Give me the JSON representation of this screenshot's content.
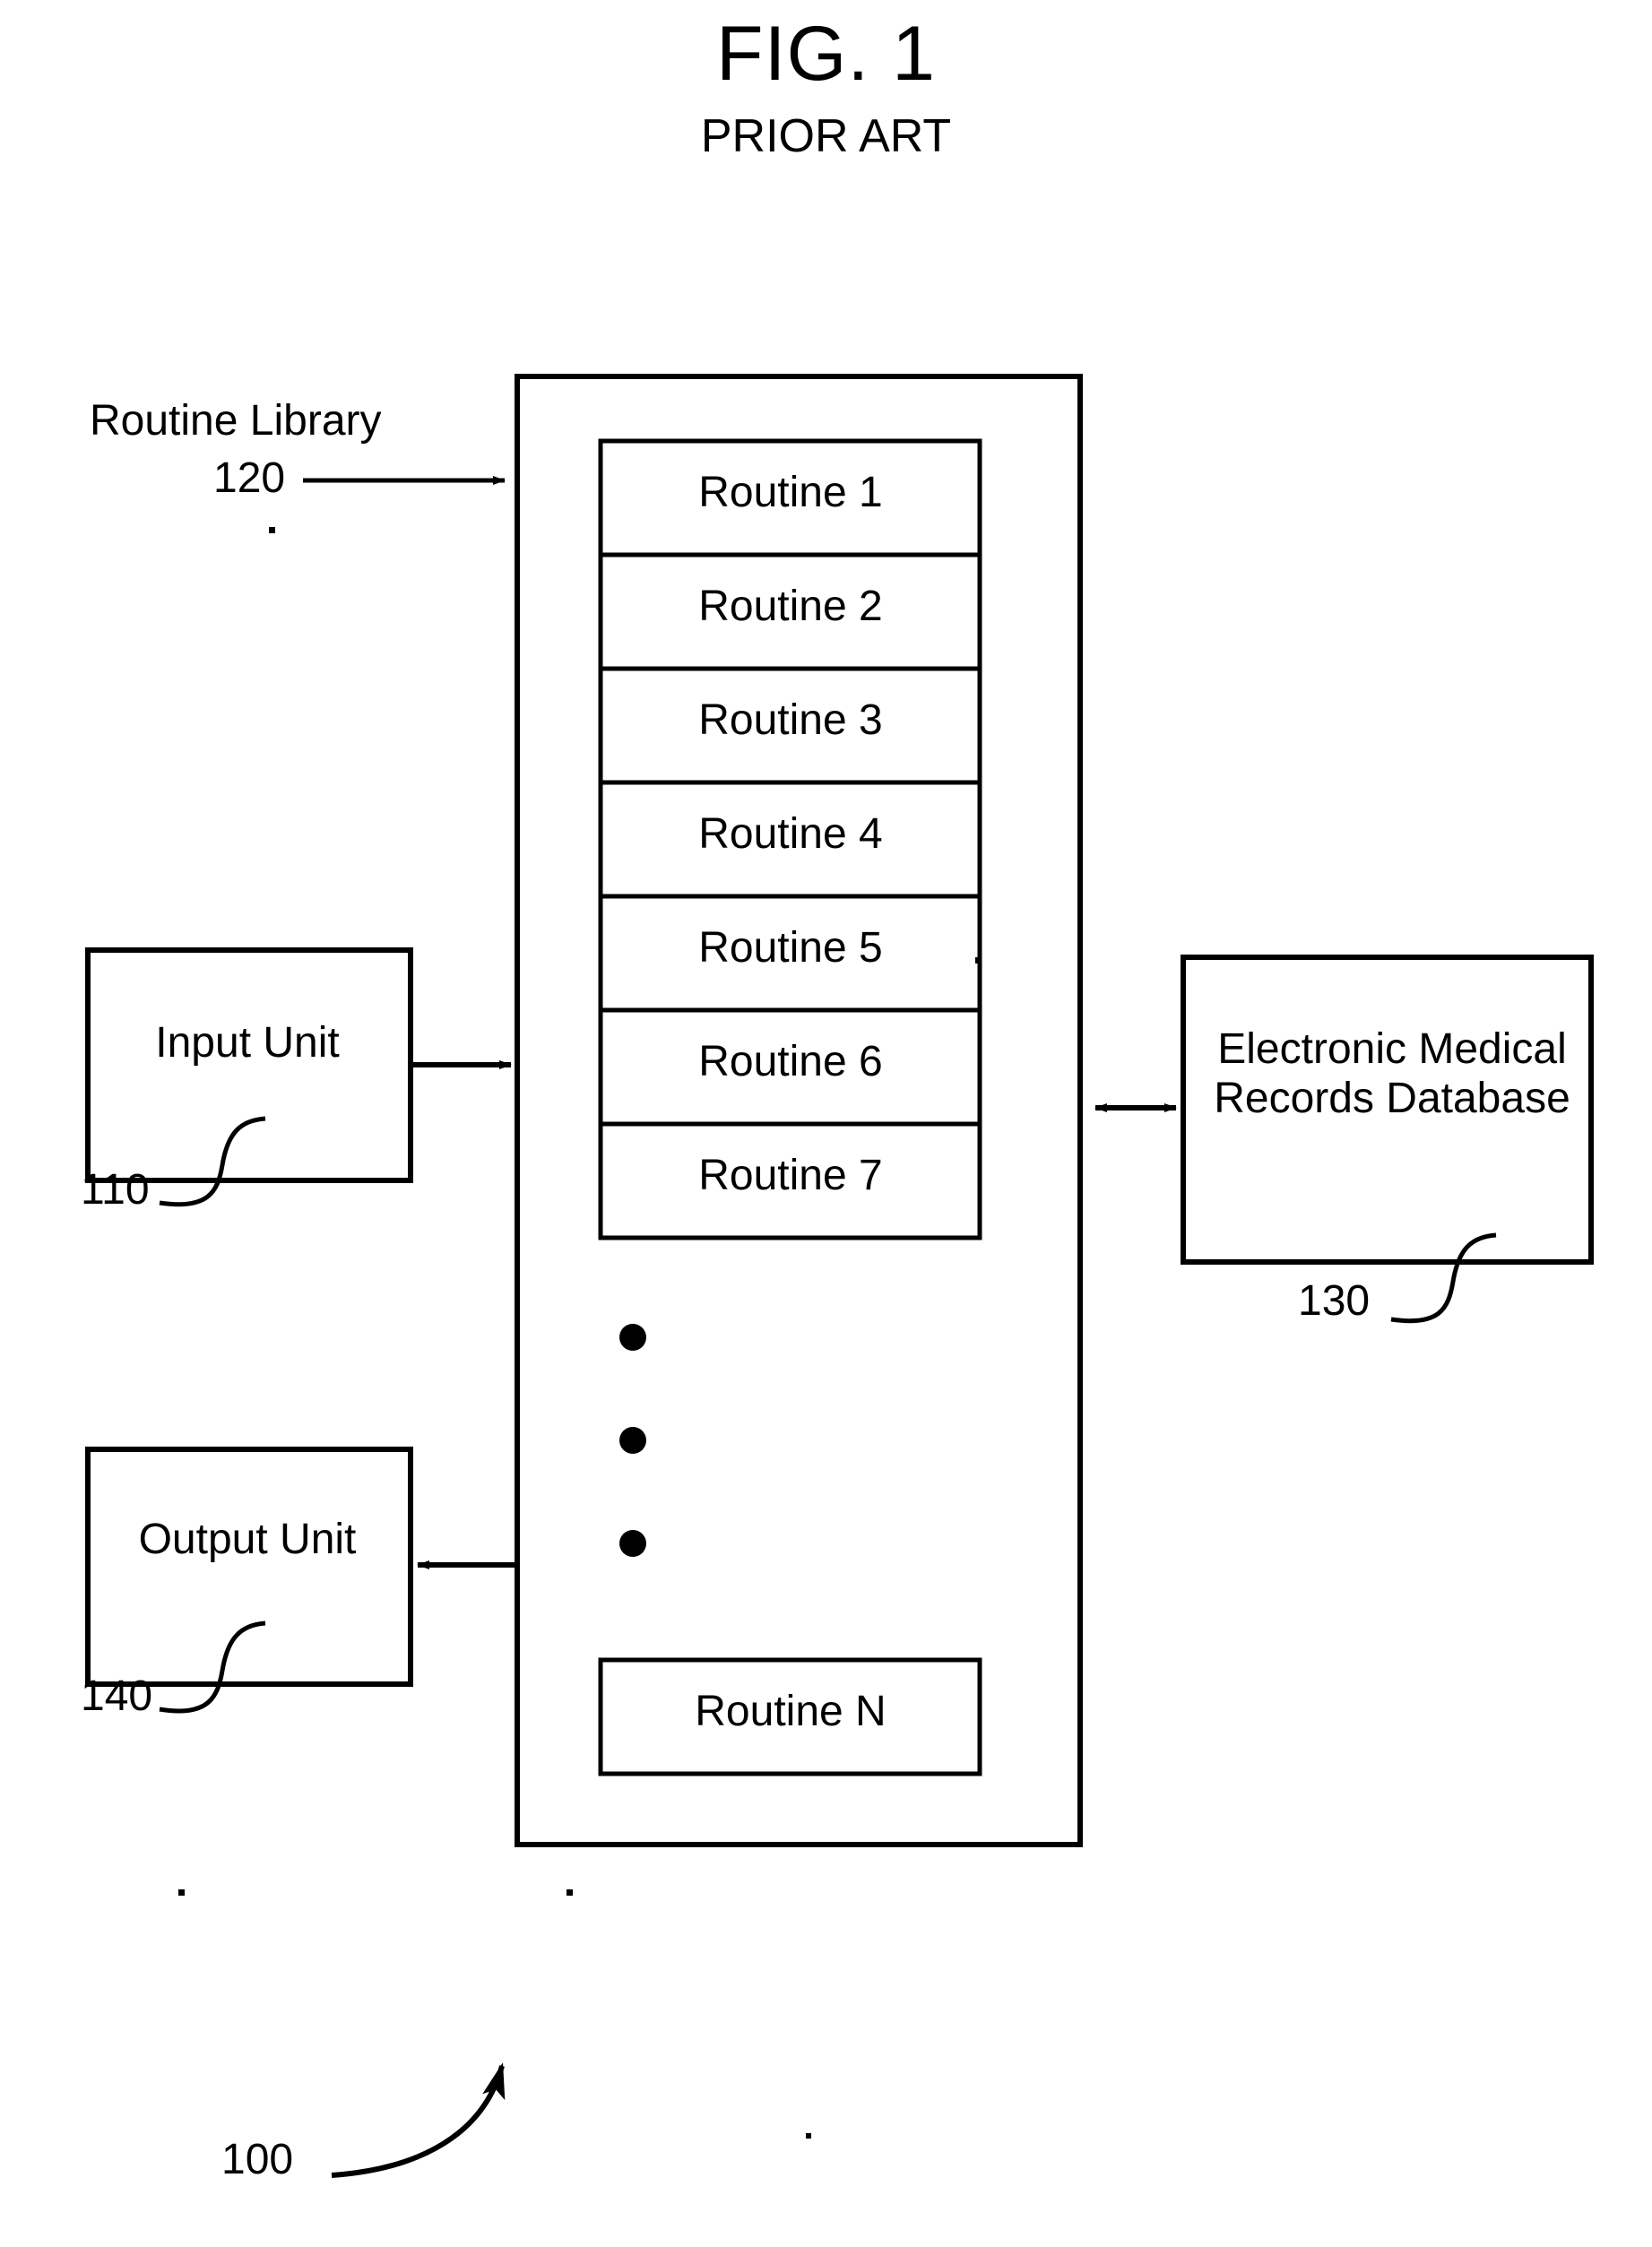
{
  "figure": {
    "title": "FIG. 1",
    "subtitle": "PRIOR ART",
    "system_ref": "100"
  },
  "routine_library": {
    "label": "Routine Library",
    "ref": "120",
    "routines": [
      {
        "label": "Routine 1"
      },
      {
        "label": "Routine 2"
      },
      {
        "label": "Routine 3"
      },
      {
        "label": "Routine 4"
      },
      {
        "label": "Routine 5"
      },
      {
        "label": "Routine 6"
      },
      {
        "label": "Routine 7"
      },
      {
        "label": "Routine N"
      }
    ],
    "ellipsis_dots": 3
  },
  "input_unit": {
    "label": "Input Unit",
    "ref": "110"
  },
  "output_unit": {
    "label": "Output Unit",
    "ref": "140"
  },
  "database": {
    "label_line1": "Electronic Medical",
    "label_line2": "Records Database",
    "ref": "130"
  },
  "style": {
    "stroke": "#000000",
    "fill": "#ffffff"
  }
}
